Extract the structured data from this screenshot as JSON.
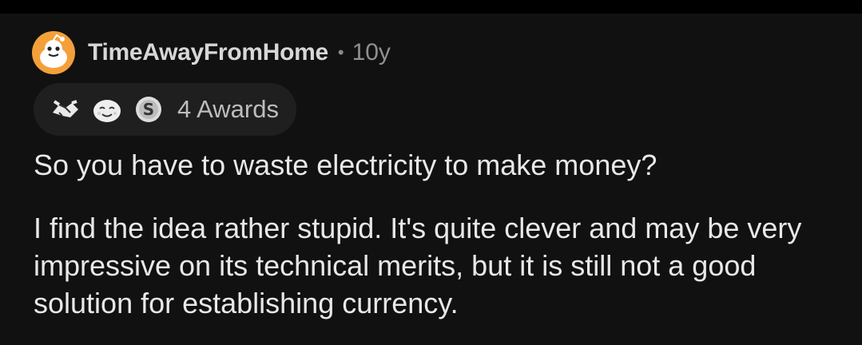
{
  "comment": {
    "username": "TimeAwayFromHome",
    "separator": "•",
    "age": "10y",
    "awards": {
      "count_label": "4 Awards",
      "icons": [
        "handshake-award-icon",
        "wholesome-award-icon",
        "silver-coin-award-icon"
      ]
    },
    "paragraphs": [
      "So you have to waste electricity to make money?",
      "I find the idea rather stupid. It's quite clever and may be very impressive on its technical merits, but it is still not a good solution for establishing currency."
    ]
  },
  "colors": {
    "background": "#111111",
    "topbar": "#000000",
    "avatar_orange": "#f3a03b",
    "award_pill": "#1f1f1f"
  }
}
